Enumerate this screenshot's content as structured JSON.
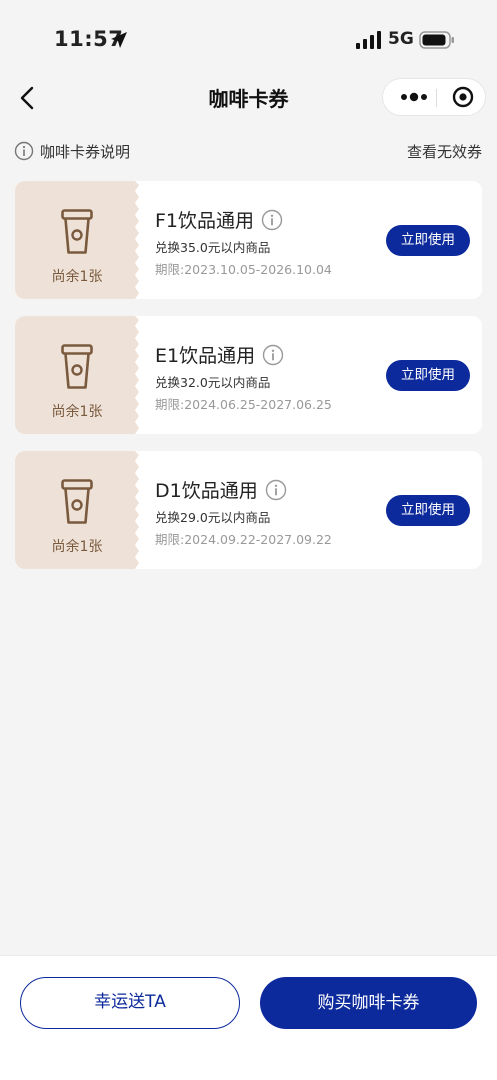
{
  "status_bar": {
    "time": "11:57",
    "network": "5G"
  },
  "header": {
    "title": "咖啡卡券"
  },
  "info_row": {
    "help_label": "咖啡卡券说明",
    "invalid_label": "查看无效券"
  },
  "coupons": [
    {
      "name": "F1饮品通用",
      "desc": "兑换35.0元以内商品",
      "period": "期限:2023.10.05-2026.10.04",
      "remain": "尚余1张",
      "button": "立即使用"
    },
    {
      "name": "E1饮品通用",
      "desc": "兑换32.0元以内商品",
      "period": "期限:2024.06.25-2027.06.25",
      "remain": "尚余1张",
      "button": "立即使用"
    },
    {
      "name": "D1饮品通用",
      "desc": "兑换29.0元以内商品",
      "period": "期限:2024.09.22-2027.09.22",
      "remain": "尚余1张",
      "button": "立即使用"
    }
  ],
  "bottom": {
    "gift_label": "幸运送TA",
    "buy_label": "购买咖啡卡券"
  },
  "colors": {
    "accent": "#0d2a9c",
    "coupon_left_bg": "#eee1d7",
    "icon_brown": "#7a5a3e"
  },
  "icons": [
    "location-arrow-icon",
    "signal-icon",
    "battery-icon",
    "back-icon",
    "more-icon",
    "target-icon",
    "info-icon",
    "coffee-cup-icon"
  ]
}
